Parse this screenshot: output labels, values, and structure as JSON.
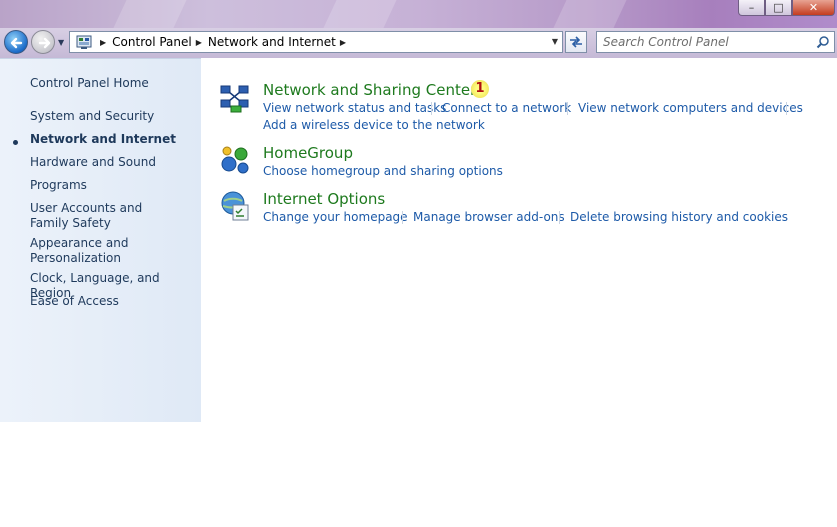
{
  "window": {
    "buttons": {
      "minimize_glyph": "–",
      "maximize_glyph": "□",
      "close_glyph": "✕"
    }
  },
  "toolbar": {
    "breadcrumbs": [
      "Control Panel",
      "Network and Internet"
    ],
    "search_placeholder": "Search Control Panel"
  },
  "sidebar": {
    "items": [
      {
        "label": "Control Panel Home"
      },
      {
        "label": "System and Security"
      },
      {
        "label": "Network and Internet"
      },
      {
        "label": "Hardware and Sound"
      },
      {
        "label": "Programs"
      },
      {
        "label": "User Accounts and Family Safety"
      },
      {
        "label": "Appearance and Personalization"
      },
      {
        "label": "Clock, Language, and Region"
      },
      {
        "label": "Ease of Access"
      }
    ]
  },
  "categories": [
    {
      "title": "Network and Sharing Center",
      "badge": "1",
      "links": [
        "View network status and tasks",
        "Connect to a network",
        "View network computers and devices",
        "Add a wireless device to the network"
      ]
    },
    {
      "title": "HomeGroup",
      "links": [
        "Choose homegroup and sharing options"
      ]
    },
    {
      "title": "Internet Options",
      "links": [
        "Change your homepage",
        "Manage browser add-ons",
        "Delete browsing history and cookies"
      ]
    }
  ],
  "colors": {
    "category_title": "#1e7a1e",
    "link": "#1d5aa8",
    "sidebar_text": "#1e395b",
    "badge_text": "#b01010"
  }
}
